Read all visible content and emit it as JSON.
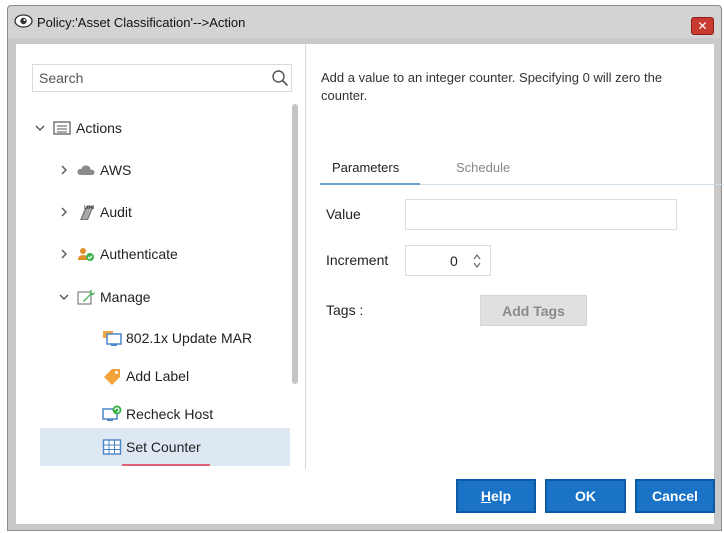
{
  "window": {
    "title": "Policy:'Asset Classification'-->Action",
    "close_glyph": "✕"
  },
  "search": {
    "placeholder": "Search",
    "value": ""
  },
  "tree": {
    "root": {
      "label": "Actions",
      "expanded": true
    },
    "items": [
      {
        "label": "AWS",
        "icon": "cloud-icon",
        "expanded": false
      },
      {
        "label": "Audit",
        "icon": "log-icon",
        "expanded": false
      },
      {
        "label": "Authenticate",
        "icon": "user-check-icon",
        "expanded": false
      },
      {
        "label": "Manage",
        "icon": "wrench-icon",
        "expanded": true
      }
    ],
    "manage_children": [
      {
        "label": "802.1x Update MAR",
        "icon": "monitor-icon"
      },
      {
        "label": "Add Label",
        "icon": "tag-icon"
      },
      {
        "label": "Recheck Host",
        "icon": "recheck-host-icon"
      },
      {
        "label": "Set Counter",
        "icon": "counter-icon",
        "selected": true
      }
    ]
  },
  "description": "Add a value to an integer counter. Specifying 0 will zero the counter.",
  "tabs": [
    {
      "label": "Parameters",
      "active": true
    },
    {
      "label": "Schedule",
      "active": false
    }
  ],
  "form": {
    "value_label": "Value",
    "value": "",
    "increment_label": "Increment",
    "increment_value": "0",
    "tags_label": "Tags :",
    "add_tags_label": "Add Tags"
  },
  "buttons": {
    "help_mnemonic": "H",
    "help_rest": "elp",
    "ok": "OK",
    "cancel": "Cancel"
  },
  "colors": {
    "button_blue": "#1a73c6",
    "selection": "#dde8f3",
    "selection_line": "#e0607a",
    "close_red": "#c93a30"
  }
}
